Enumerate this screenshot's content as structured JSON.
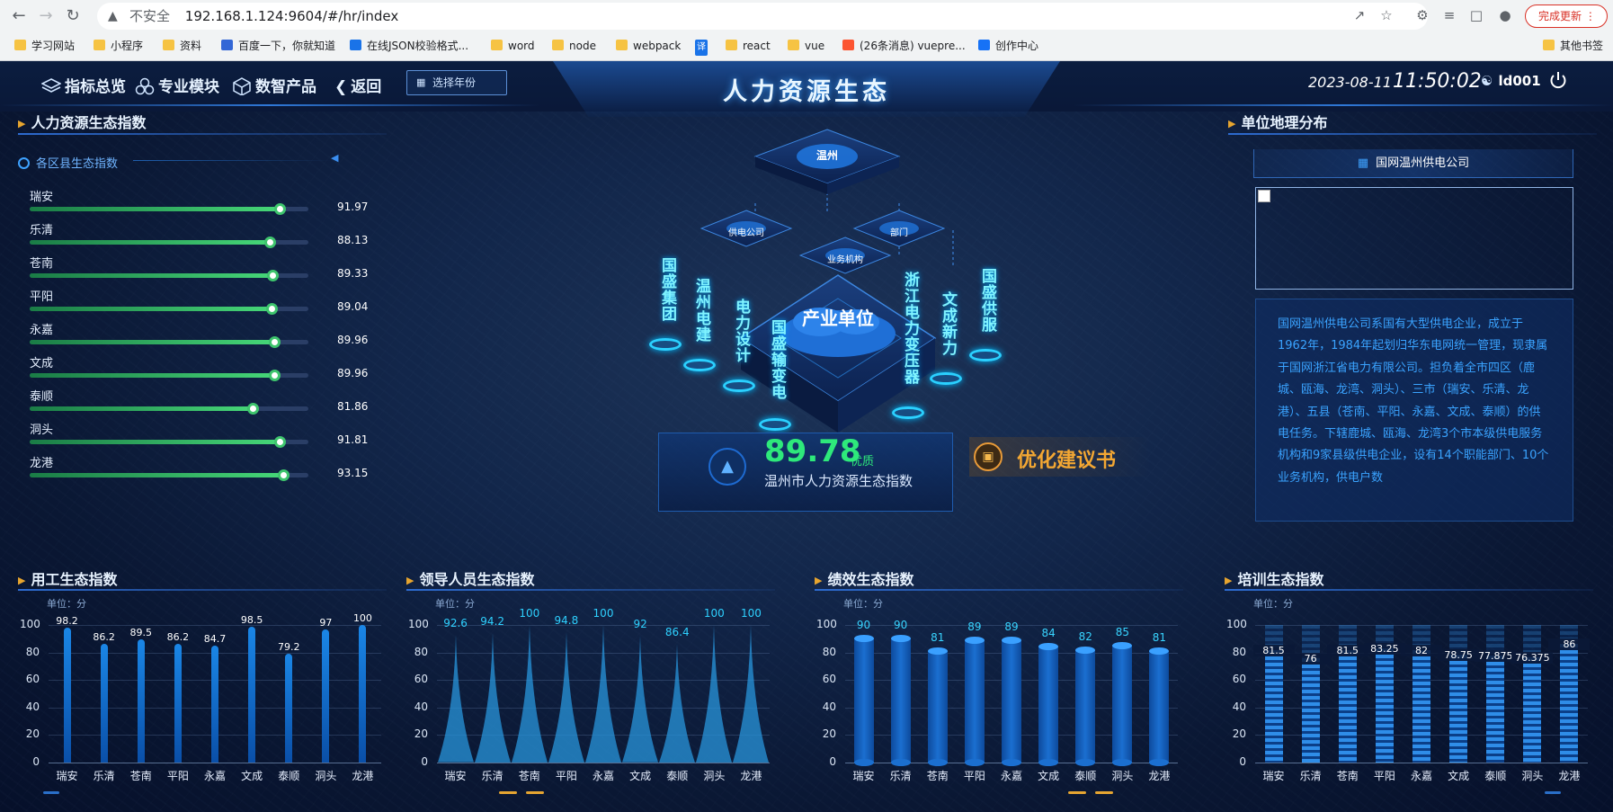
{
  "browser": {
    "security_label": "不安全",
    "url": "192.168.1.124:9604/#/hr/index",
    "update_button": "完成更新",
    "bookmarks": [
      "学习网站",
      "小程序",
      "资料",
      "百度一下，你就知道",
      "在线JSON校验格式...",
      "word",
      "node",
      "webpack",
      "译",
      "react",
      "vue",
      "(26条消息) vuepre...",
      "创作中心"
    ],
    "other_bookmarks": "其他书签"
  },
  "topbar": {
    "nav": [
      "指标总览",
      "专业模块",
      "数智产品",
      "返回"
    ],
    "year_select": "选择年份",
    "title": "人力资源生态",
    "date": "2023-08-11",
    "time": "11:50:02",
    "user": "ld001"
  },
  "left": {
    "title": "人力资源生态指数",
    "subtitle": "各区县生态指数",
    "districts": [
      {
        "name": "瑞安",
        "value": "91.97",
        "level": 0.897
      },
      {
        "name": "乐清",
        "value": "88.13",
        "level": 0.861
      },
      {
        "name": "苍南",
        "value": "89.33",
        "level": 0.872
      },
      {
        "name": "平阳",
        "value": "89.04",
        "level": 0.869
      },
      {
        "name": "永嘉",
        "value": "89.96",
        "level": 0.878
      },
      {
        "name": "文成",
        "value": "89.96",
        "level": 0.878
      },
      {
        "name": "泰顺",
        "value": "81.86",
        "level": 0.8
      },
      {
        "name": "洞头",
        "value": "91.81",
        "level": 0.896
      },
      {
        "name": "龙港",
        "value": "93.15",
        "level": 0.909
      }
    ]
  },
  "right": {
    "title": "单位地理分布",
    "company": "国网温州供电公司",
    "description": "国网温州供电公司系国有大型供电企业，成立于1962年，1984年起划归华东电网统一管理，现隶属于国网浙江省电力有限公司。担负着全市四区（鹿城、瓯海、龙湾、洞头）、三市（瑞安、乐清、龙港）、五县（苍南、平阳、永嘉、文成、泰顺）的供电任务。下辖鹿城、瓯海、龙湾3个市本级供电服务机构和9家县级供电企业，设有14个职能部门、10个业务机构，供电户数"
  },
  "center": {
    "top_platform": "温州",
    "small_platforms": [
      "供电公司",
      "部门",
      "业务机构"
    ],
    "main_platform": "产业单位",
    "units": [
      "国盛集团",
      "温州电建",
      "电力设计",
      "国盛输变电",
      "浙江电力变压器",
      "文成新力",
      "国盛供服"
    ],
    "score": "89.78",
    "score_level": "优质",
    "score_label": "温州市人力资源生态指数",
    "advice": "优化建议书"
  },
  "charts": [
    {
      "title": "用工生态指数",
      "unit": "单位：分"
    },
    {
      "title": "领导人员生态指数",
      "unit": "单位：分"
    },
    {
      "title": "绩效生态指数",
      "unit": "单位：分"
    },
    {
      "title": "培训生态指数",
      "unit": "单位：分"
    }
  ],
  "chart_data": [
    {
      "type": "bar",
      "title": "用工生态指数",
      "ylabel": "单位：分",
      "ylim": [
        0,
        100
      ],
      "yticks": [
        0,
        20,
        40,
        60,
        80,
        100
      ],
      "categories": [
        "瑞安",
        "乐清",
        "苍南",
        "平阳",
        "永嘉",
        "文成",
        "泰顺",
        "洞头",
        "龙港"
      ],
      "values": [
        98.2,
        86.2,
        89.5,
        86.2,
        84.7,
        98.5,
        79.2,
        97,
        100
      ],
      "labels": [
        "98.2",
        "86.2",
        "89.5",
        "86.2",
        "84.7",
        "98.5",
        "79.2",
        "97",
        "100"
      ]
    },
    {
      "type": "area",
      "title": "领导人员生态指数",
      "ylabel": "单位：分",
      "ylim": [
        0,
        100
      ],
      "yticks": [
        0,
        20,
        40,
        60,
        80,
        100
      ],
      "categories": [
        "瑞安",
        "乐清",
        "苍南",
        "平阳",
        "永嘉",
        "文成",
        "泰顺",
        "洞头",
        "龙港"
      ],
      "values": [
        92.6,
        94.2,
        100,
        94.8,
        100,
        92,
        86.4,
        100,
        100
      ],
      "labels": [
        "92.6",
        "94.2",
        "100",
        "94.8",
        "100",
        "92",
        "86.4",
        "100",
        "100"
      ]
    },
    {
      "type": "bar",
      "title": "绩效生态指数",
      "ylabel": "单位：分",
      "ylim": [
        0,
        100
      ],
      "yticks": [
        0,
        20,
        40,
        60,
        80,
        100
      ],
      "categories": [
        "瑞安",
        "乐清",
        "苍南",
        "平阳",
        "永嘉",
        "文成",
        "泰顺",
        "洞头",
        "龙港"
      ],
      "values": [
        90,
        90,
        81,
        89,
        89,
        84,
        82,
        85,
        81
      ],
      "labels": [
        "90",
        "90",
        "81",
        "89",
        "89",
        "84",
        "82",
        "85",
        "81"
      ]
    },
    {
      "type": "bar",
      "title": "培训生态指数",
      "ylabel": "单位：分",
      "ylim": [
        0,
        100
      ],
      "yticks": [
        0,
        20,
        40,
        60,
        80,
        100
      ],
      "categories": [
        "瑞安",
        "乐清",
        "苍南",
        "平阳",
        "永嘉",
        "文成",
        "泰顺",
        "洞头",
        "龙港"
      ],
      "values": [
        81.5,
        76,
        81.5,
        83.25,
        82,
        78.75,
        77.875,
        76.375,
        86
      ],
      "labels": [
        "81.5",
        "76",
        "81.5",
        "83.25",
        "82",
        "78.75",
        "77.875",
        "76.375",
        "86"
      ]
    }
  ],
  "colors": {
    "accent": "#3ea2ff",
    "green": "#2ee97b",
    "orange": "#f3a733",
    "bar": "#1a86e6"
  }
}
